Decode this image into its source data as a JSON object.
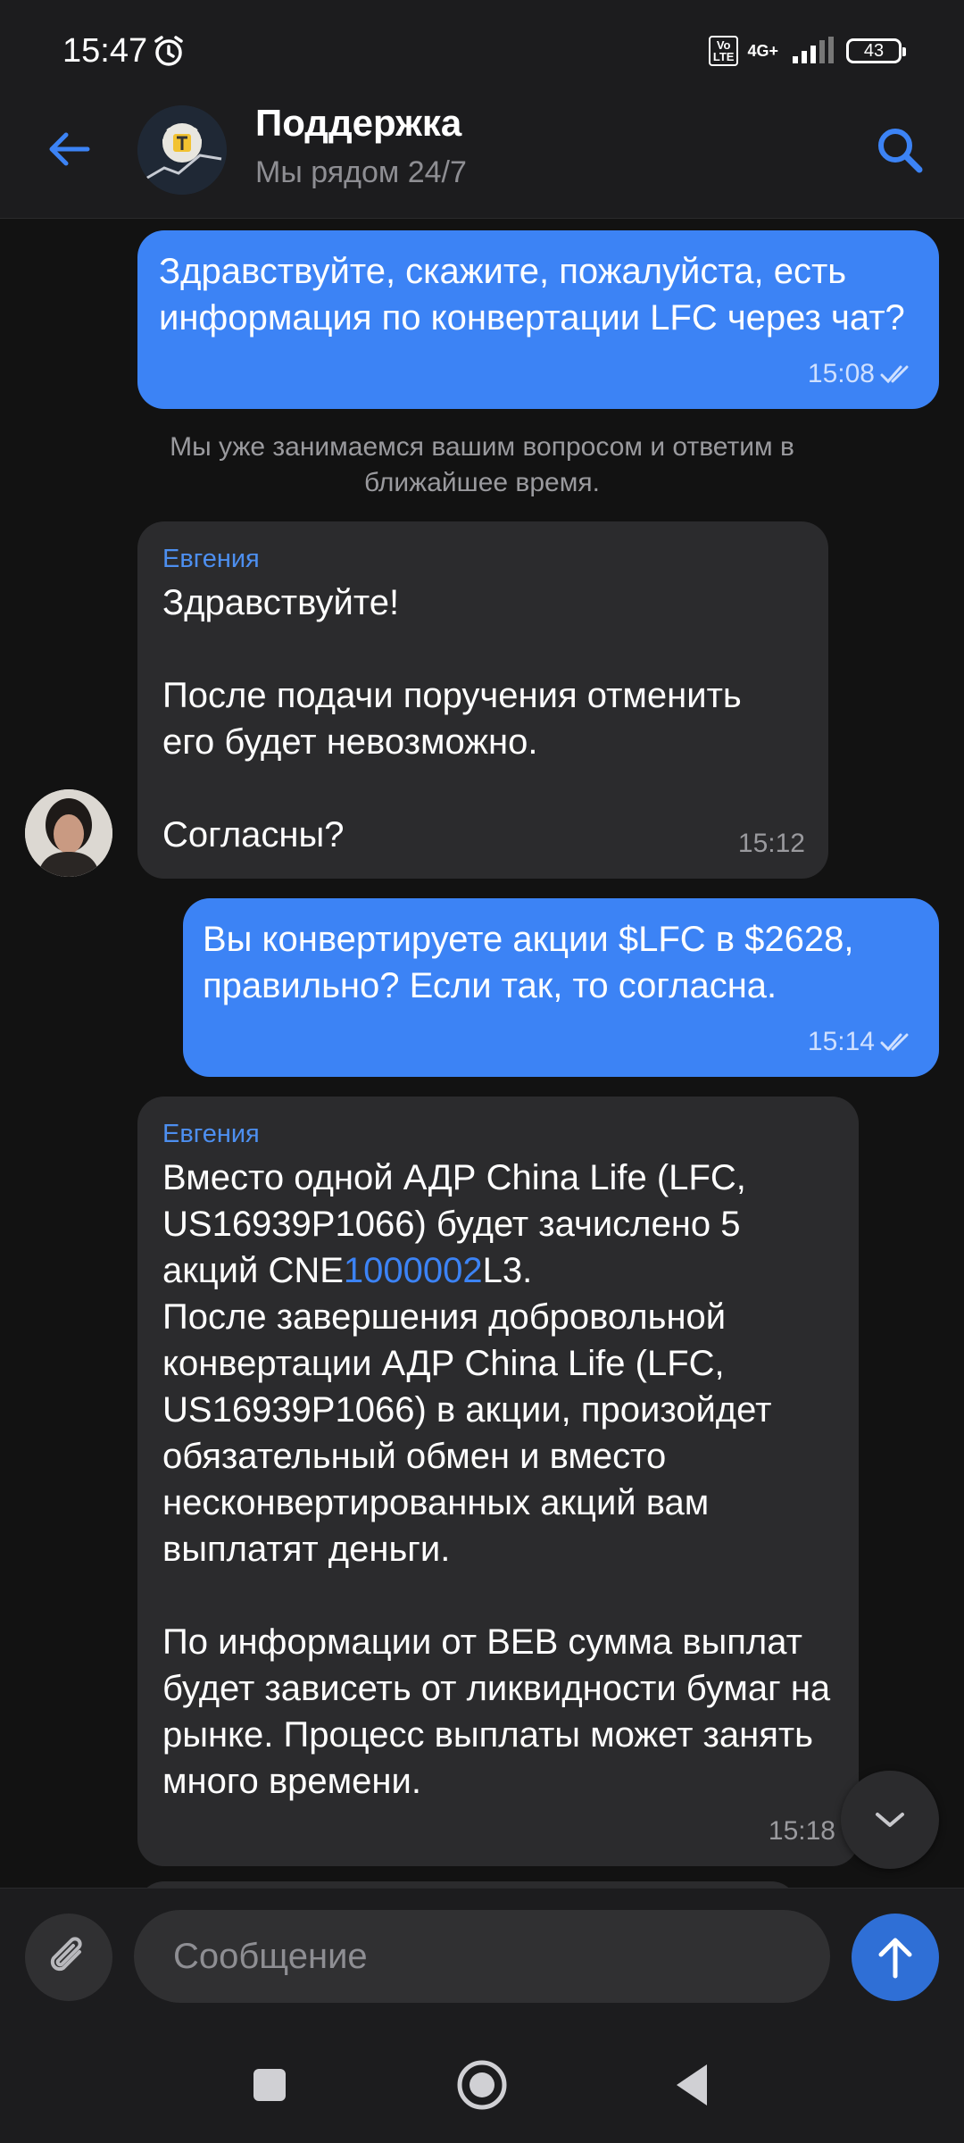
{
  "status": {
    "time": "15:47",
    "volte": "Vo\nLTE",
    "network": "4G+",
    "battery": "43"
  },
  "header": {
    "title": "Поддержка",
    "subtitle": "Мы рядом 24/7"
  },
  "messages": {
    "m1": {
      "text": "Здравствуйте, скажите, пожалуйста, есть информация по конвертации LFC через чат?",
      "time": "15:08"
    },
    "system": "Мы уже занимаемся вашим вопросом и ответим в ближайшее время.",
    "m2": {
      "sender": "Евгения",
      "text": "Здравствуйте!\n\nПосле подачи поручения отменить его будет невозможно.\n\nСогласны?",
      "time": "15:12"
    },
    "m3": {
      "text": "Вы конвертируете акции $LFC в $2628, правильно? Если так, то согласна.",
      "time": "15:14"
    },
    "m4": {
      "sender": "Евгения",
      "text_a": "Вместо одной АДР China Life (LFC, US16939P1066) будет зачислено 5 акций CNE",
      "text_link": "1000002",
      "text_b": "L3.\nПосле завершения добровольной конвертации АДР China Life (LFC, US16939P1066) в акции, произойдет обязательный обмен и вместо несконвертированных акций вам выплатят деньги.\n\nПо информации от BEB сумма выплат будет зависеть от ликвидности бумаг на рынке. Процесс выплаты может занять много времени.",
      "time": "15:18"
    }
  },
  "input": {
    "placeholder": "Сообщение"
  },
  "colors": {
    "accent": "#3c83f5",
    "incoming": "#2b2b2d",
    "background": "#121212"
  }
}
